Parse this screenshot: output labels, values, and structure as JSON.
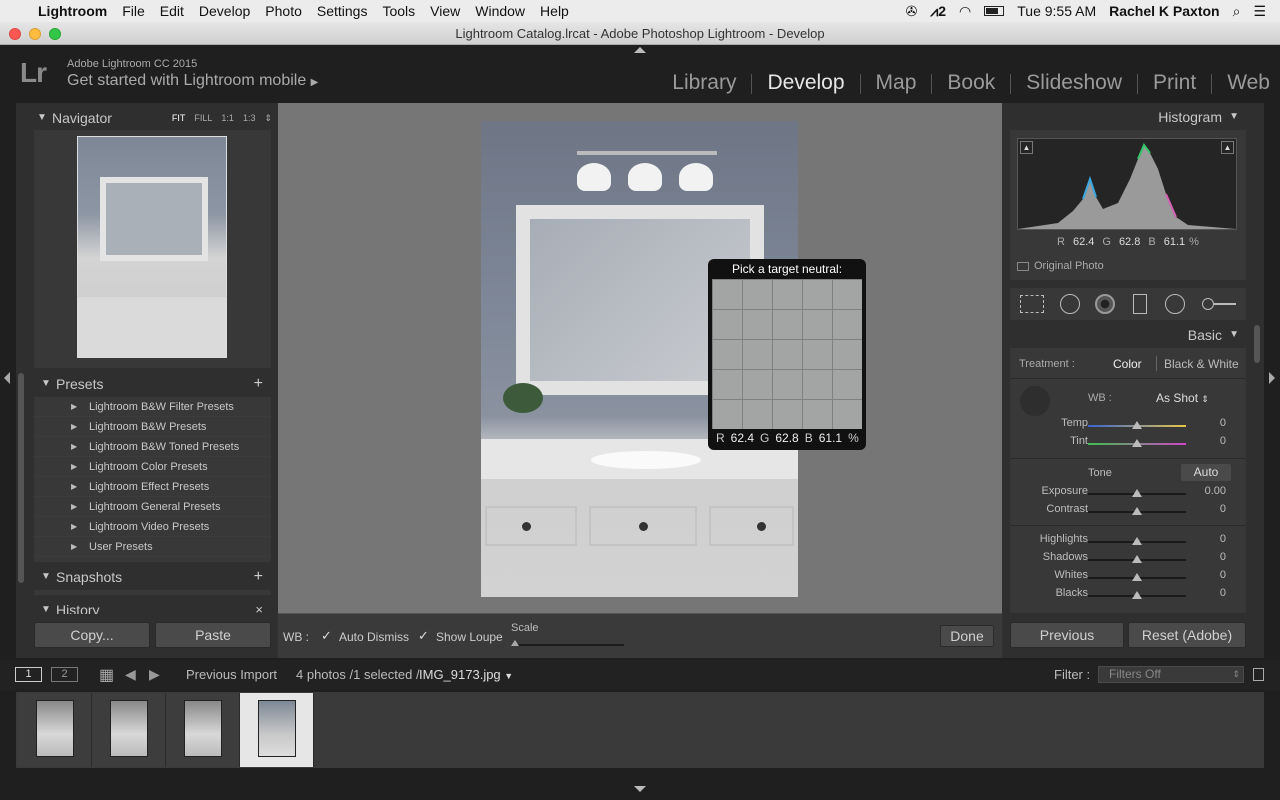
{
  "menubar": {
    "app_name": "Lightroom",
    "items": [
      "File",
      "Edit",
      "Develop",
      "Photo",
      "Settings",
      "Tools",
      "View",
      "Window",
      "Help"
    ],
    "badge_count": "2",
    "clock": "Tue 9:55 AM",
    "user": "Rachel K Paxton"
  },
  "window": {
    "title": "Lightroom Catalog.lrcat - Adobe Photoshop Lightroom - Develop"
  },
  "identity": {
    "logo": "Lr",
    "version": "Adobe Lightroom CC 2015",
    "mobile_label": "Get started with Lightroom mobile",
    "modules": [
      "Library",
      "Develop",
      "Map",
      "Book",
      "Slideshow",
      "Print",
      "Web"
    ],
    "active_module": "Develop"
  },
  "navigator": {
    "title": "Navigator",
    "zoom_options": [
      "FIT",
      "FILL",
      "1:1",
      "1:3"
    ]
  },
  "presets": {
    "title": "Presets",
    "items": [
      "Lightroom B&W Filter Presets",
      "Lightroom B&W Presets",
      "Lightroom B&W Toned Presets",
      "Lightroom Color Presets",
      "Lightroom Effect Presets",
      "Lightroom General Presets",
      "Lightroom Video Presets",
      "User Presets"
    ]
  },
  "snapshots": {
    "title": "Snapshots"
  },
  "history": {
    "title": "History"
  },
  "left_buttons": {
    "copy": "Copy...",
    "paste": "Paste"
  },
  "loupe": {
    "title": "Pick a target neutral:",
    "r_label": "R",
    "r_value": "62.4",
    "g_label": "G",
    "g_value": "62.8",
    "b_label": "B",
    "b_value": "61.1",
    "unit": "%"
  },
  "toolbar": {
    "wb_label": "WB :",
    "auto_dismiss": "Auto Dismiss",
    "show_loupe": "Show Loupe",
    "scale_label": "Scale",
    "done": "Done"
  },
  "histogram": {
    "title": "Histogram",
    "r_label": "R",
    "r_value": "62.4",
    "g_label": "G",
    "g_value": "62.8",
    "b_label": "B",
    "b_value": "61.1",
    "unit": "%",
    "original_photo": "Original Photo"
  },
  "basic": {
    "title": "Basic",
    "treatment_label": "Treatment :",
    "color": "Color",
    "bw": "Black & White",
    "wb_label": "WB :",
    "wb_value": "As Shot",
    "tone_label": "Tone",
    "auto": "Auto",
    "sliders": [
      {
        "label": "Temp",
        "value": "0"
      },
      {
        "label": "Tint",
        "value": "0"
      },
      {
        "label": "Exposure",
        "value": "0.00"
      },
      {
        "label": "Contrast",
        "value": "0"
      },
      {
        "label": "Highlights",
        "value": "0"
      },
      {
        "label": "Shadows",
        "value": "0"
      },
      {
        "label": "Whites",
        "value": "0"
      },
      {
        "label": "Blacks",
        "value": "0"
      }
    ]
  },
  "right_buttons": {
    "previous": "Previous",
    "reset": "Reset (Adobe)"
  },
  "filmstrip_bar": {
    "screen1": "1",
    "screen2": "2",
    "source": "Previous Import",
    "count": "4 photos /1 selected /",
    "filename": "IMG_9173.jpg",
    "filter_label": "Filter :",
    "filter_value": "Filters Off"
  },
  "colors": {
    "accent": "#e6e6e6",
    "panel_bg": "#383838",
    "app_bg": "#1f1f1f"
  }
}
